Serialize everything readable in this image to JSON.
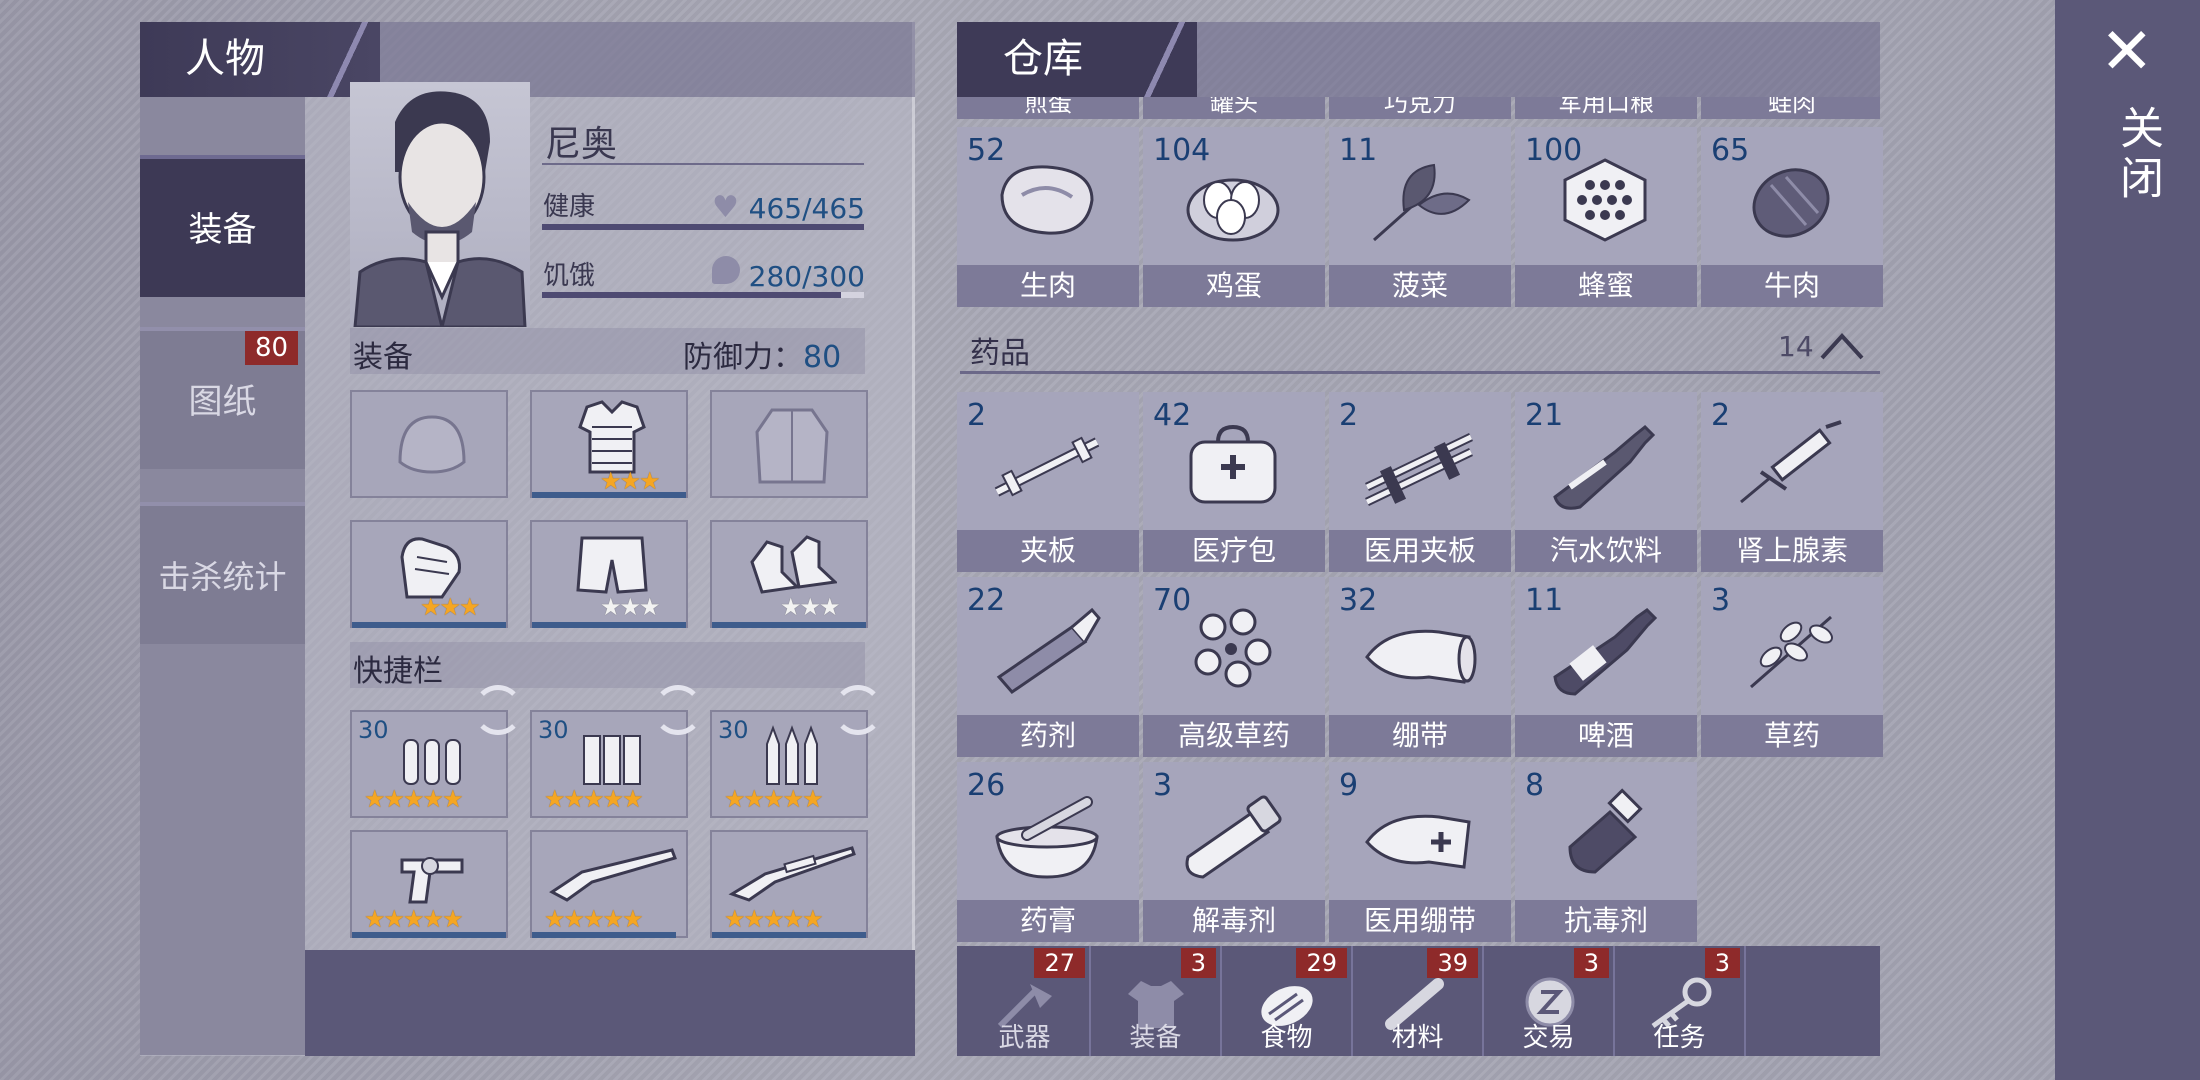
{
  "character_panel": {
    "title": "人物",
    "side_tabs": [
      {
        "label": "装备",
        "active": true
      },
      {
        "label": "图纸",
        "badge": "80"
      },
      {
        "label": "击杀统计"
      }
    ],
    "name": "尼奥",
    "health": {
      "label": "健康",
      "value": "465/465",
      "fill": 1.0
    },
    "hunger": {
      "label": "饥饿",
      "value": "280/300",
      "fill": 0.93
    },
    "equipment_label": "装备",
    "defense_label": "防御力：",
    "defense_value": "80",
    "equipment_slots": [
      {
        "icon": "helmet-icon",
        "stars": 0
      },
      {
        "icon": "armor-vest-icon",
        "stars": 3
      },
      {
        "icon": "jacket-icon",
        "stars": 0
      },
      {
        "icon": "gloves-icon",
        "stars": 3
      },
      {
        "icon": "shorts-icon",
        "stars": 3
      },
      {
        "icon": "shoes-icon",
        "stars": 3
      }
    ],
    "quickbar_label": "快捷栏",
    "quickbar_slots": [
      {
        "icon": "bullets-icon",
        "count": "30",
        "stars": 5
      },
      {
        "icon": "shells-icon",
        "count": "30",
        "stars": 5
      },
      {
        "icon": "rifle-bullets-icon",
        "count": "30",
        "stars": 5
      },
      {
        "icon": "revolver-icon",
        "stars": 5
      },
      {
        "icon": "shotgun-icon",
        "stars": 5
      },
      {
        "icon": "sniper-rifle-icon",
        "stars": 5
      }
    ]
  },
  "warehouse": {
    "title": "仓库",
    "cut_row_labels": [
      "煎蛋",
      "罐头",
      "巧克力",
      "军用口粮",
      "蛙肉"
    ],
    "food_items": [
      {
        "count": "52",
        "label": "生肉",
        "icon": "raw-meat-icon"
      },
      {
        "count": "104",
        "label": "鸡蛋",
        "icon": "eggs-icon"
      },
      {
        "count": "11",
        "label": "菠菜",
        "icon": "spinach-icon"
      },
      {
        "count": "100",
        "label": "蜂蜜",
        "icon": "honeycomb-icon"
      },
      {
        "count": "65",
        "label": "牛肉",
        "icon": "beef-icon"
      }
    ],
    "medicine_category": {
      "label": "药品",
      "count": "14"
    },
    "medicine_items": [
      {
        "count": "2",
        "label": "夹板",
        "icon": "splint-icon"
      },
      {
        "count": "42",
        "label": "医疗包",
        "icon": "medkit-icon"
      },
      {
        "count": "2",
        "label": "医用夹板",
        "icon": "medical-splint-icon"
      },
      {
        "count": "21",
        "label": "汽水饮料",
        "icon": "soda-bottle-icon"
      },
      {
        "count": "2",
        "label": "肾上腺素",
        "icon": "syringe-icon"
      },
      {
        "count": "22",
        "label": "药剂",
        "icon": "medicine-tube-icon"
      },
      {
        "count": "70",
        "label": "高级草药",
        "icon": "premium-herb-icon"
      },
      {
        "count": "32",
        "label": "绷带",
        "icon": "bandage-roll-icon"
      },
      {
        "count": "11",
        "label": "啤酒",
        "icon": "beer-bottle-icon"
      },
      {
        "count": "3",
        "label": "草药",
        "icon": "herb-icon"
      },
      {
        "count": "26",
        "label": "药膏",
        "icon": "mortar-icon"
      },
      {
        "count": "3",
        "label": "解毒剂",
        "icon": "vial-icon"
      },
      {
        "count": "9",
        "label": "医用绷带",
        "icon": "medical-bandage-icon"
      },
      {
        "count": "8",
        "label": "抗毒剂",
        "icon": "antitoxin-icon"
      }
    ],
    "bottom_tabs": [
      {
        "label": "武器",
        "badge": "27",
        "icon": "axe-icon"
      },
      {
        "label": "装备",
        "badge": "3",
        "icon": "shirt-icon"
      },
      {
        "label": "食物",
        "badge": "29",
        "icon": "meat-icon",
        "active": true
      },
      {
        "label": "材料",
        "badge": "39",
        "icon": "log-icon"
      },
      {
        "label": "交易",
        "badge": "3",
        "icon": "coin-icon"
      },
      {
        "label": "任务",
        "badge": "3",
        "icon": "key-icon"
      }
    ]
  },
  "close_label": "关闭",
  "colors": {
    "accent_dark": "#3e3a57",
    "badge_red": "#8e2a2a",
    "count_blue": "#1f4f83",
    "star_gold": "#f5a623"
  }
}
